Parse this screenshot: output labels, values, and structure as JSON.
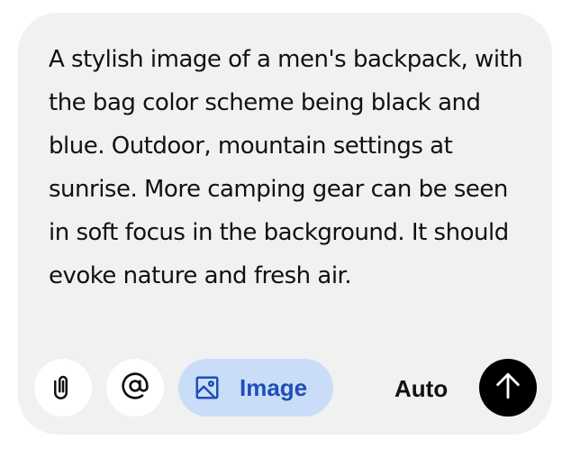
{
  "composer": {
    "prompt_text": "A stylish image of a men's backpack, with the bag color scheme being black and blue. Outdoor, mountain settings at sunrise. More camping gear can be seen in soft focus in the background. It should evoke nature and fresh air."
  },
  "toolbar": {
    "attach_icon": "paperclip-icon",
    "mention_icon": "at-sign-icon",
    "image_mode": {
      "icon": "image-icon",
      "label": "Image",
      "active": true
    },
    "mode_label": "Auto",
    "send_icon": "arrow-up-icon"
  },
  "colors": {
    "composer_bg": "#f1f1f1",
    "button_bg": "#ffffff",
    "image_chip_bg": "#c9ddf9",
    "image_chip_fg": "#1f4fb5",
    "send_bg": "#000000",
    "text": "#111111"
  }
}
